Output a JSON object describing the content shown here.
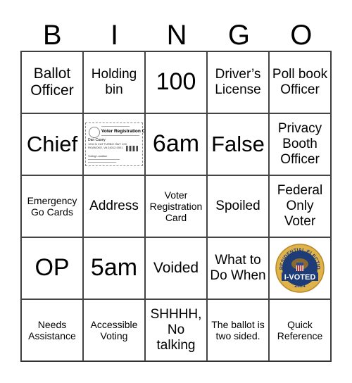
{
  "header": [
    "B",
    "I",
    "N",
    "G",
    "O"
  ],
  "cells": [
    "Ballot Officer",
    "Holding bin",
    "100",
    "Driver’s License",
    "Poll book Officer",
    "Chief",
    "",
    "6am",
    "False",
    "Privacy Booth Officer",
    "Emergency Go Cards",
    "Address",
    "Voter Registration Card",
    "Spoiled",
    "Federal Only Voter",
    "OP",
    "5am",
    "Voided",
    "What to Do When",
    "",
    "Needs Assistance",
    "Accessible Voting",
    "SHHHH, No talking",
    "The ballot is two sided.",
    "Quick Reference"
  ],
  "images": {
    "voter_card": {
      "title": "Voter Registration Card",
      "name": "Dan Casey",
      "address1": "1234 N CAT TURBO HWY 100",
      "address2": "ROANOKE, VA 24012-0001",
      "location": "Voting Location"
    },
    "i_voted_badge": {
      "top_text": "PRESIDENTIAL ELECTION",
      "main_text": "I-VOTED",
      "year": "2024"
    }
  }
}
